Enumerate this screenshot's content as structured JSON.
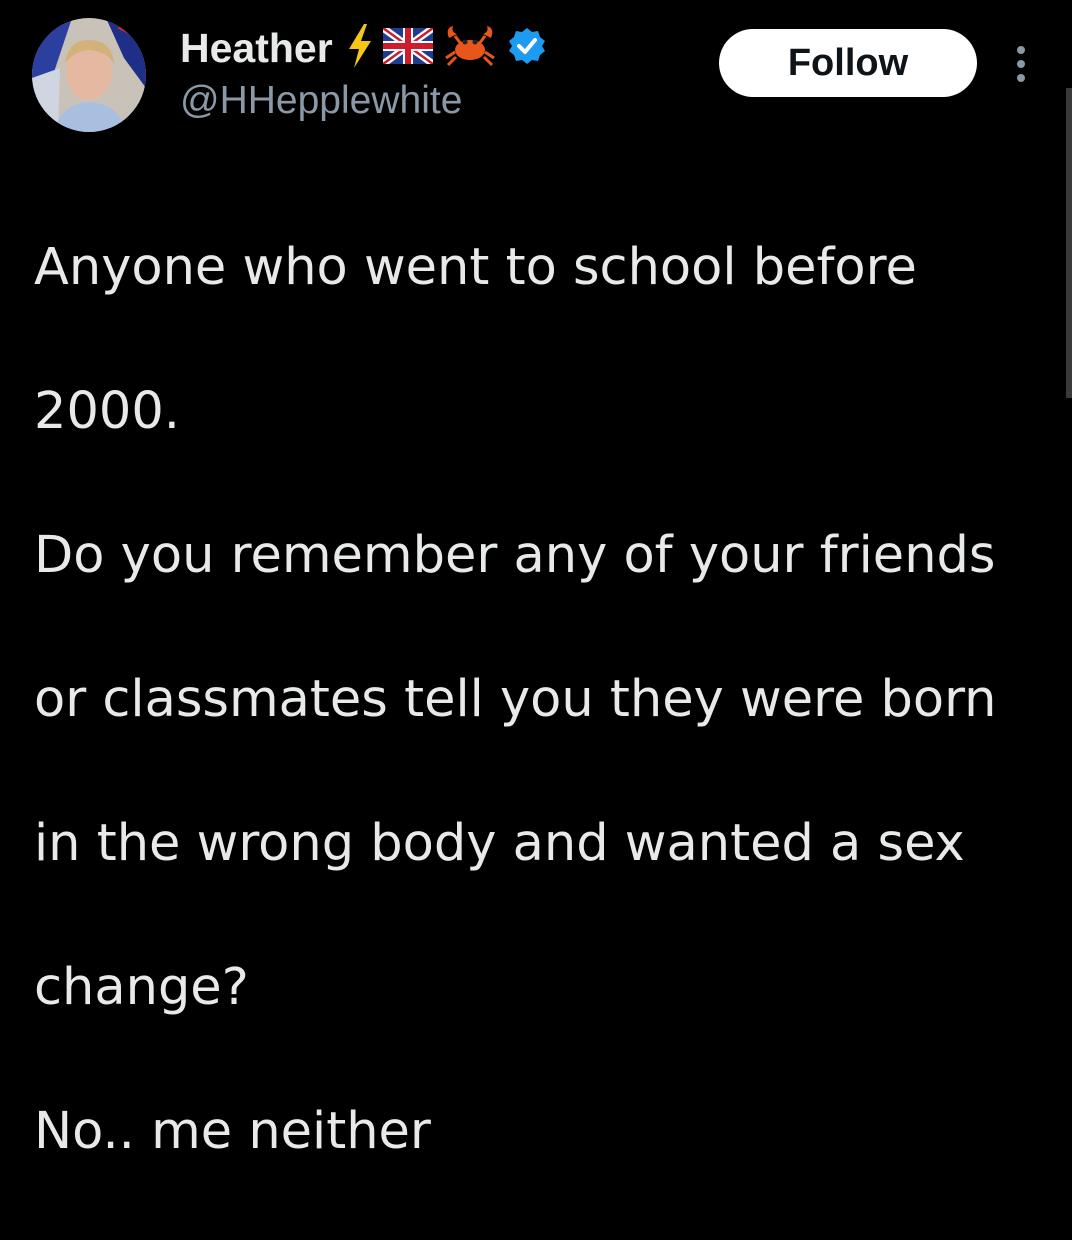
{
  "author": {
    "display_name": "Heather",
    "handle": "@HHepplewhite",
    "badges": [
      "lightning-icon",
      "uk-flag-icon",
      "crab-icon",
      "verified-badge-icon"
    ]
  },
  "follow_button": {
    "label": "Follow"
  },
  "tweet": {
    "lines": [
      "Anyone who went to school before",
      "2000.",
      "Do you remember any of your friends",
      "or classmates tell you they were born",
      "in the wrong body and wanted a sex",
      "change?",
      "No.. me neither"
    ]
  },
  "colors": {
    "background": "#000000",
    "text": "#e7e9ea",
    "secondary_text": "#8b98a5",
    "verified_blue": "#1d9bf0",
    "lightning_yellow": "#f5c518",
    "crab_orange": "#e8561c"
  }
}
